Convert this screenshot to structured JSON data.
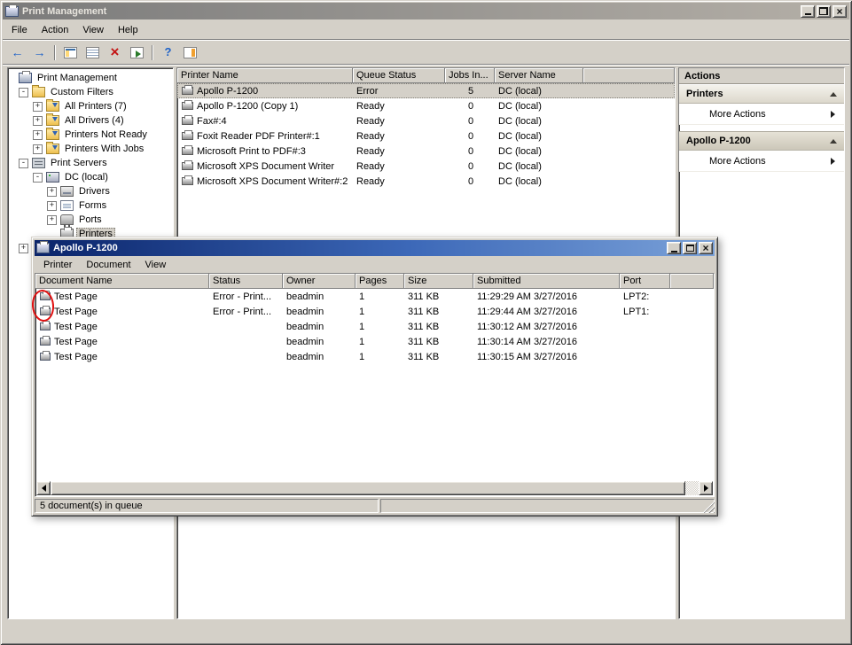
{
  "window": {
    "title": "Print Management",
    "menu": [
      "File",
      "Action",
      "View",
      "Help"
    ],
    "controls": [
      "minimize",
      "restore",
      "close"
    ],
    "toolbar": [
      {
        "type": "button",
        "icon": "back-icon"
      },
      {
        "type": "button",
        "icon": "forward-icon"
      },
      {
        "type": "separator"
      },
      {
        "type": "button",
        "icon": "console-tree-icon"
      },
      {
        "type": "button",
        "icon": "list-view-icon"
      },
      {
        "type": "button",
        "icon": "delete-icon"
      },
      {
        "type": "button",
        "icon": "export-icon"
      },
      {
        "type": "separator"
      },
      {
        "type": "button",
        "icon": "help-icon"
      },
      {
        "type": "button",
        "icon": "action-pane-icon"
      }
    ]
  },
  "tree": {
    "items": [
      {
        "label": "Print Management",
        "icon": "console",
        "level": 0
      },
      {
        "label": "Custom Filters",
        "icon": "folder",
        "level": 1,
        "expander": "minus"
      },
      {
        "label": "All Printers (7)",
        "icon": "filter",
        "level": 2,
        "expander": "plus"
      },
      {
        "label": "All Drivers (4)",
        "icon": "filter",
        "level": 2,
        "expander": "plus"
      },
      {
        "label": "Printers Not Ready",
        "icon": "filter",
        "level": 2,
        "expander": "plus"
      },
      {
        "label": "Printers With Jobs",
        "icon": "filter",
        "level": 2,
        "expander": "plus"
      },
      {
        "label": "Print Servers",
        "icon": "servers",
        "level": 1,
        "expander": "minus"
      },
      {
        "label": "DC (local)",
        "icon": "server",
        "level": 2,
        "expander": "minus"
      },
      {
        "label": "Drivers",
        "icon": "drivers",
        "level": 3,
        "expander": "plus"
      },
      {
        "label": "Forms",
        "icon": "forms",
        "level": 3,
        "expander": "plus"
      },
      {
        "label": "Ports",
        "icon": "ports",
        "level": 3,
        "expander": "plus"
      },
      {
        "label": "Printers",
        "icon": "printers",
        "level": 3,
        "selected": true
      },
      {
        "label": "",
        "icon": "none",
        "level": 1,
        "expander": "plus"
      }
    ]
  },
  "printer_list": {
    "columns": [
      "Printer Name",
      "Queue Status",
      "Jobs In...",
      "Server Name"
    ],
    "rows": [
      {
        "name": "Apollo P-1200",
        "queue_status": "Error",
        "jobs": "5",
        "server": "DC (local)",
        "selected": true
      },
      {
        "name": "Apollo P-1200 (Copy 1)",
        "queue_status": "Ready",
        "jobs": "0",
        "server": "DC (local)"
      },
      {
        "name": "Fax#:4",
        "queue_status": "Ready",
        "jobs": "0",
        "server": "DC (local)"
      },
      {
        "name": "Foxit Reader PDF Printer#:1",
        "queue_status": "Ready",
        "jobs": "0",
        "server": "DC (local)"
      },
      {
        "name": "Microsoft Print to PDF#:3",
        "queue_status": "Ready",
        "jobs": "0",
        "server": "DC (local)"
      },
      {
        "name": "Microsoft XPS Document Writer",
        "queue_status": "Ready",
        "jobs": "0",
        "server": "DC (local)"
      },
      {
        "name": "Microsoft XPS Document Writer#:2",
        "queue_status": "Ready",
        "jobs": "0",
        "server": "DC (local)"
      }
    ]
  },
  "actions": {
    "title": "Actions",
    "sections": [
      {
        "header": "Printers",
        "items": [
          "More Actions"
        ]
      },
      {
        "header": "Apollo P-1200",
        "items": [
          "More Actions"
        ]
      }
    ]
  },
  "queue_window": {
    "title": "Apollo P-1200",
    "menu": [
      "Printer",
      "Document",
      "View"
    ],
    "controls": [
      "minimize",
      "maximize",
      "close"
    ],
    "columns": [
      "Document Name",
      "Status",
      "Owner",
      "Pages",
      "Size",
      "Submitted",
      "Port"
    ],
    "rows": [
      {
        "name": "Test Page",
        "status": "Error - Print...",
        "owner": "beadmin",
        "pages": "1",
        "size": "311 KB",
        "submitted": "11:29:29 AM 3/27/2016",
        "port": "LPT2:"
      },
      {
        "name": "Test Page",
        "status": "Error - Print...",
        "owner": "beadmin",
        "pages": "1",
        "size": "311 KB",
        "submitted": "11:29:44 AM 3/27/2016",
        "port": "LPT1:"
      },
      {
        "name": "Test Page",
        "status": "",
        "owner": "beadmin",
        "pages": "1",
        "size": "311 KB",
        "submitted": "11:30:12 AM 3/27/2016",
        "port": ""
      },
      {
        "name": "Test Page",
        "status": "",
        "owner": "beadmin",
        "pages": "1",
        "size": "311 KB",
        "submitted": "11:30:14 AM 3/27/2016",
        "port": ""
      },
      {
        "name": "Test Page",
        "status": "",
        "owner": "beadmin",
        "pages": "1",
        "size": "311 KB",
        "submitted": "11:30:15 AM 3/27/2016",
        "port": ""
      }
    ],
    "status_bar": "5 document(s) in queue"
  },
  "colors": {
    "title_active_start": "#0a246a",
    "title_active_mid": "#3c68b8",
    "title_active_end": "#7aa1d8",
    "title_inactive_start": "#7b7b7b",
    "title_inactive_end": "#b4afa7",
    "selection_inactive": "#d4d0c8",
    "annotation_red": "#e01010"
  }
}
